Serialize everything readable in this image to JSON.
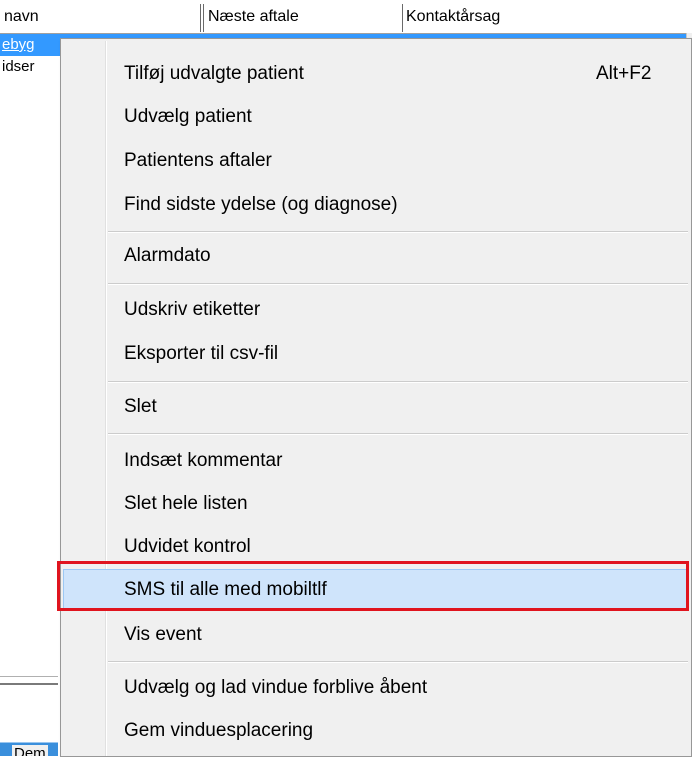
{
  "list": {
    "columns": [
      "navn",
      "Næste aftale",
      "Kontaktårsag"
    ],
    "rows": [
      "ebyg",
      "idser"
    ],
    "bottom_tab_text": "Dem"
  },
  "menu": {
    "items": [
      {
        "label": "Tilføj udvalgte patient",
        "shortcut": "Alt+F2"
      },
      {
        "label": "Udvælg patient"
      },
      {
        "label": "Patientens aftaler"
      },
      {
        "label": "Find sidste ydelse (og diagnose)"
      },
      {
        "label": "Alarmdato"
      },
      {
        "label": "Udskriv etiketter"
      },
      {
        "label": "Eksporter til csv-fil"
      },
      {
        "label": "Slet"
      },
      {
        "label": "Indsæt kommentar"
      },
      {
        "label": "Slet hele listen"
      },
      {
        "label": "Udvidet kontrol"
      },
      {
        "label": "SMS til alle med mobiltlf"
      },
      {
        "label": "Vis event"
      },
      {
        "label": "Udvælg og lad vindue forblive åbent"
      },
      {
        "label": "Gem vinduesplacering"
      }
    ],
    "highlighted_index": 11
  },
  "colors": {
    "selection": "#3399ff",
    "menu_background": "#f0f0f0",
    "hover_background": "#cfe4fb",
    "annotation_red": "#e0141e"
  }
}
